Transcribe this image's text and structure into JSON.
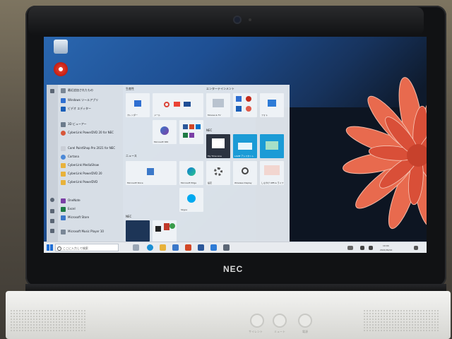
{
  "device": {
    "brand_logo": "NEC"
  },
  "desktop": {
    "icons": [
      {
        "name": "recycle-bin-icon"
      },
      {
        "name": "app-shortcut-icon"
      }
    ]
  },
  "start_menu": {
    "app_list": [
      {
        "label": "最近追加されたもの",
        "icon": "clock-icon"
      },
      {
        "label": "Windows ツールアプリ",
        "icon": "app-icon"
      },
      {
        "label": "ビデオ エディター",
        "icon": "video-icon"
      },
      {
        "label": "3D ビューアー",
        "icon": "cube-icon"
      },
      {
        "label": "CyberLink PowerDVD 20 for NEC",
        "icon": "disc-icon"
      },
      {
        "label": "Corel PaintShop Pro 2021 for NEC",
        "icon": "paint-icon"
      },
      {
        "label": "Cortana",
        "icon": "circle-icon"
      },
      {
        "label": "CyberLink MediaShow",
        "icon": "folder-icon"
      },
      {
        "label": "CyberLink PowerDVD 20",
        "icon": "folder-icon"
      },
      {
        "label": "CyberLink PowerDVD",
        "icon": "folder-icon"
      },
      {
        "label": "OneNote",
        "icon": "onenote-icon"
      },
      {
        "label": "Excel",
        "icon": "excel-icon"
      },
      {
        "label": "Microsoft Store",
        "icon": "store-icon"
      },
      {
        "label": "Microsoft Music Player 10",
        "icon": "music-icon"
      }
    ],
    "groups": [
      {
        "label": "生産性"
      },
      {
        "label": "エンターテインメント"
      },
      {
        "label": "NEC"
      },
      {
        "label": "ニュース"
      },
      {
        "label": "NEC"
      }
    ],
    "tiles": [
      {
        "label": "カレンダー",
        "icon": "calendar-icon"
      },
      {
        "label": "メール",
        "icon": "mail-icon"
      },
      {
        "label": "Microsoft 365",
        "icon": "office-icon"
      },
      {
        "label": "Microsoft Store",
        "icon": "store-icon"
      },
      {
        "label": "Microsoft Edge",
        "icon": "edge-icon"
      },
      {
        "label": "Skype",
        "icon": "skype-icon"
      },
      {
        "label": "Movies & TV",
        "icon": "film-icon"
      },
      {
        "label": "フォト",
        "icon": "photos-icon"
      },
      {
        "label": "My Time Line",
        "icon": "timeline-icon"
      },
      {
        "label": "LAVIE アシスタント",
        "icon": "lavie-icon"
      },
      {
        "label": "設定",
        "icon": "gear-icon"
      },
      {
        "label": "Wireless Display",
        "icon": "wireless-icon"
      },
      {
        "label": "しもやけ Office ライフ",
        "icon": "office-life-icon"
      }
    ]
  },
  "taskbar": {
    "search_placeholder": "ここに入力して検索",
    "pinned": [
      "task-view-icon",
      "edge-icon",
      "explorer-icon",
      "store-icon",
      "mail-icon",
      "word-icon",
      "photos-icon",
      "settings-icon"
    ],
    "clock_time": "10:04",
    "clock_date": "2021/09/24"
  },
  "base": {
    "button_labels": [
      "サイレント",
      "ミュート",
      "電源"
    ]
  },
  "colors": {
    "accent": "#2a67b0",
    "taskbar": "#e8ebef",
    "screen_bezel": "#111214",
    "base": "#ecebe8",
    "flower": "#e86a4e"
  }
}
